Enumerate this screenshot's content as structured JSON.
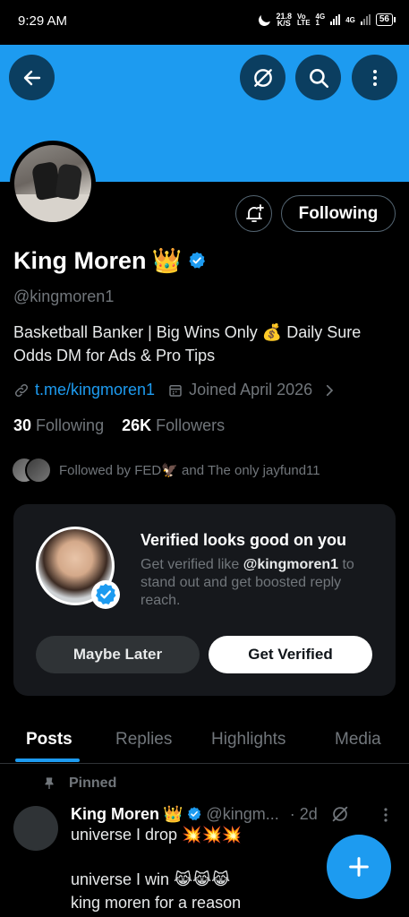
{
  "status_bar": {
    "time": "9:29 AM",
    "speed_value": "21.8",
    "speed_unit": "K/S",
    "net1_top": "Vo",
    "net1_bottom": "LTE",
    "net2_top": "4G",
    "net2_bottom": "1",
    "net3": "4G",
    "battery": "56"
  },
  "profile": {
    "name": "King Moren",
    "name_emoji": "👑",
    "handle": "@kingmoren1",
    "bio": "Basketball Banker | Big Wins Only 💰 Daily Sure Odds  DM for Ads & Pro Tips",
    "link": "t.me/kingmoren1",
    "joined": "Joined April 2026",
    "following_count": "30",
    "following_label": "Following",
    "followers_count": "26K",
    "followers_label": "Followers",
    "followed_by": "Followed by FED🦅 and The only jayfund11",
    "following_button": "Following"
  },
  "verified_card": {
    "title": "Verified looks good on you",
    "text_prefix": "Get verified like ",
    "text_handle": "@kingmoren1",
    "text_suffix": " to stand out and get boosted reply reach.",
    "maybe_label": "Maybe Later",
    "get_label": "Get Verified"
  },
  "tabs": [
    "Posts",
    "Replies",
    "Highlights",
    "Media"
  ],
  "post": {
    "pinned_label": "Pinned",
    "name": "King Moren",
    "name_emoji": "👑",
    "handle": "@kingm...",
    "time": "· 2d",
    "line1": "universe I drop 💥💥💥",
    "line2": "universe I win 😹😹😹",
    "line3": "king moren for a reason"
  },
  "colors": {
    "accent": "#1d9bf0",
    "background": "#000000",
    "muted": "#71767b"
  }
}
